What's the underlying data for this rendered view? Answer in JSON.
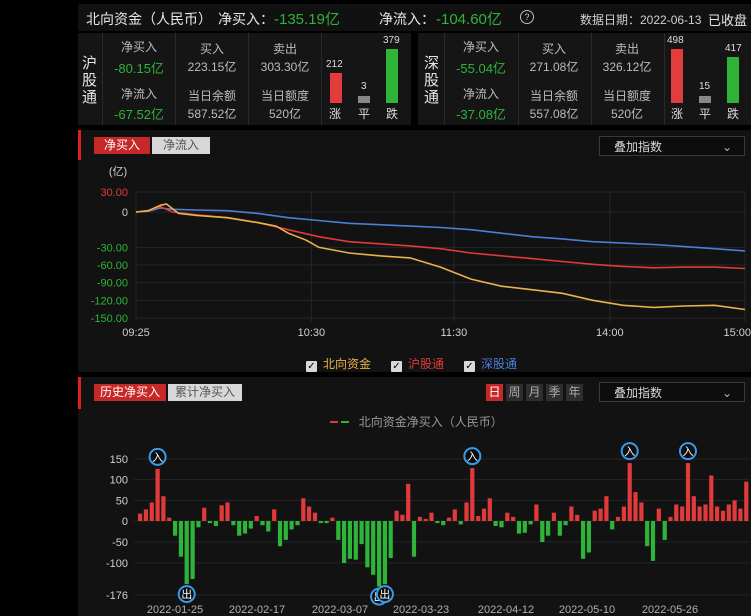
{
  "header": {
    "title": "北向资金（人民币）",
    "net_buy_label": "净买入：",
    "net_buy_value": "-135.19亿",
    "net_inflow_label": "净流入：",
    "net_inflow_value": "-104.60亿",
    "help_icon": "question-circle-icon",
    "date_label": "数据日期：2022-06-13",
    "status": "已收盘"
  },
  "hu": {
    "name_chars": [
      "沪",
      "股",
      "通"
    ],
    "net_buy_label": "净买入",
    "net_buy_value": "-80.15亿",
    "buy_label": "买入",
    "buy_value": "223.15亿",
    "sell_label": "卖出",
    "sell_value": "303.30亿",
    "net_inflow_label": "净流入",
    "net_inflow_value": "-67.52亿",
    "balance_label": "当日余额",
    "balance_value": "587.52亿",
    "quota_label": "当日额度",
    "quota_value": "520亿",
    "up_count": "212",
    "flat_count": "3",
    "down_count": "379",
    "up_label": "涨",
    "flat_label": "平",
    "down_label": "跌"
  },
  "shen": {
    "name_chars": [
      "深",
      "股",
      "通"
    ],
    "net_buy_label": "净买入",
    "net_buy_value": "-55.04亿",
    "buy_label": "买入",
    "buy_value": "271.08亿",
    "sell_label": "卖出",
    "sell_value": "326.12亿",
    "net_inflow_label": "净流入",
    "net_inflow_value": "-37.08亿",
    "balance_label": "当日余额",
    "balance_value": "557.08亿",
    "quota_label": "当日额度",
    "quota_value": "520亿",
    "up_count": "498",
    "flat_count": "15",
    "down_count": "417",
    "up_label": "涨",
    "flat_label": "平",
    "down_label": "跌"
  },
  "intraday": {
    "tabs": [
      "净买入",
      "净流入"
    ],
    "active_tab": 0,
    "overlay_dropdown": "叠加指数",
    "chevron_icon": "chevron-down-icon",
    "legend": [
      {
        "label": "北向资金",
        "color": "#e8b44a",
        "checked": true
      },
      {
        "label": "沪股通",
        "color": "#e03a3a",
        "checked": true
      },
      {
        "label": "深股通",
        "color": "#4a7fd8",
        "checked": true
      }
    ]
  },
  "history": {
    "tabs": [
      "历史净买入",
      "累计净买入"
    ],
    "active_tab": 0,
    "period_buttons": [
      "日",
      "周",
      "月",
      "季",
      "年"
    ],
    "active_period": 0,
    "overlay_dropdown": "叠加指数",
    "legend_label": "北向资金净买入（人民币）",
    "marker_in": "入",
    "marker_out": "出"
  },
  "chart_data": [
    {
      "type": "line",
      "ylabel": "(亿)",
      "yticks": [
        30,
        0,
        -30,
        -60,
        -90,
        -120,
        -150
      ],
      "ylim": [
        -150,
        40
      ],
      "xticks": [
        "09:25",
        "10:30",
        "11:30",
        "14:00",
        "15:00"
      ],
      "x_fraction_domain": [
        0,
        1
      ],
      "series": [
        {
          "name": "北向资金",
          "color": "#e8b44a",
          "x": [
            0,
            0.02,
            0.04,
            0.05,
            0.06,
            0.07,
            0.08,
            0.1,
            0.15,
            0.2,
            0.23,
            0.25,
            0.28,
            0.3,
            0.35,
            0.4,
            0.45,
            0.5,
            0.55,
            0.6,
            0.65,
            0.7,
            0.75,
            0.8,
            0.85,
            0.9,
            0.95,
            1.0
          ],
          "y": [
            0,
            2,
            10,
            12,
            5,
            -2,
            -3,
            -5,
            -8,
            -15,
            -20,
            -30,
            -40,
            -50,
            -58,
            -62,
            -65,
            -78,
            -95,
            -105,
            -110,
            -115,
            -125,
            -132,
            -135,
            -133,
            -132,
            -138
          ]
        },
        {
          "name": "沪股通",
          "color": "#e03a3a",
          "x": [
            0,
            0.02,
            0.04,
            0.06,
            0.1,
            0.15,
            0.2,
            0.25,
            0.3,
            0.35,
            0.4,
            0.45,
            0.5,
            0.55,
            0.6,
            0.65,
            0.7,
            0.75,
            0.8,
            0.85,
            0.9,
            0.95,
            1.0
          ],
          "y": [
            0,
            2,
            8,
            0,
            -4,
            -8,
            -15,
            -25,
            -35,
            -42,
            -45,
            -48,
            -52,
            -58,
            -62,
            -66,
            -70,
            -74,
            -77,
            -79,
            -78,
            -78,
            -80
          ]
        },
        {
          "name": "深股通",
          "color": "#4a7fd8",
          "x": [
            0,
            0.02,
            0.04,
            0.06,
            0.1,
            0.15,
            0.2,
            0.25,
            0.3,
            0.35,
            0.4,
            0.45,
            0.5,
            0.55,
            0.6,
            0.65,
            0.7,
            0.75,
            0.8,
            0.85,
            0.9,
            0.95,
            1.0
          ],
          "y": [
            0,
            1,
            6,
            4,
            3,
            2,
            -2,
            -8,
            -12,
            -16,
            -18,
            -20,
            -22,
            -25,
            -30,
            -35,
            -38,
            -42,
            -44,
            -46,
            -49,
            -52,
            -55
          ]
        }
      ]
    },
    {
      "type": "bar",
      "yticks": [
        150,
        100,
        50,
        0,
        -50,
        -100,
        -176
      ],
      "ylim": [
        -176,
        165
      ],
      "xticks": [
        "2022-01-25",
        "2022-02-17",
        "2022-03-07",
        "2022-03-23",
        "2022-04-12",
        "2022-05-10",
        "2022-05-26"
      ],
      "values": [
        18,
        28,
        45,
        126,
        60,
        8,
        -35,
        -85,
        -150,
        -138,
        -15,
        32,
        -5,
        -12,
        38,
        45,
        -10,
        -35,
        -30,
        -18,
        12,
        -10,
        -25,
        28,
        -60,
        -45,
        -20,
        -10,
        55,
        35,
        20,
        -5,
        -5,
        8,
        -45,
        -100,
        -90,
        -92,
        -55,
        -110,
        -128,
        -156,
        -150,
        -88,
        25,
        15,
        90,
        -85,
        10,
        5,
        20,
        -5,
        -10,
        8,
        28,
        -8,
        45,
        128,
        12,
        30,
        55,
        -12,
        -15,
        20,
        10,
        -30,
        -28,
        -8,
        40,
        -50,
        -35,
        20,
        -35,
        -10,
        35,
        15,
        -90,
        -75,
        25,
        30,
        60,
        -20,
        10,
        35,
        140,
        70,
        45,
        -60,
        -95,
        30,
        -45,
        10,
        40,
        35,
        140,
        60,
        35,
        40,
        110,
        35,
        25,
        40,
        50,
        30,
        95
      ]
    }
  ]
}
